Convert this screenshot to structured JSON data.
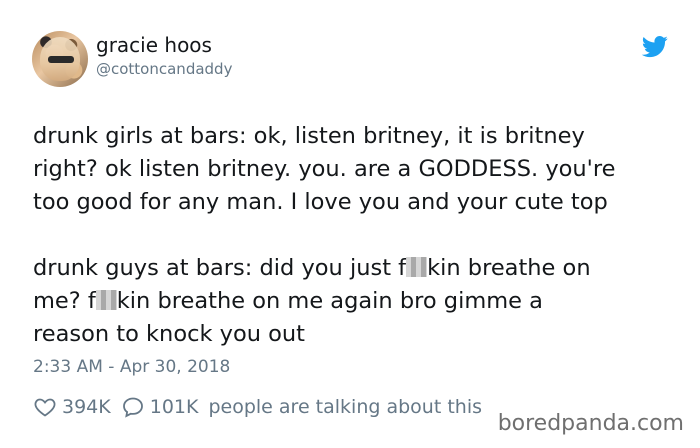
{
  "author": {
    "display_name": "gracie hoos",
    "handle": "@cottoncandaddy"
  },
  "tweet": {
    "paragraph1_lines": [
      "drunk girls at bars: ok, listen britney, it is britney",
      "right? ok listen britney. you. are a GODDESS. you're",
      "too good for any man. I love you and your cute top"
    ],
    "paragraph2": {
      "line1_before": "drunk guys at bars: did you just f",
      "line1_after": "kin breathe on",
      "line2_before": "me? f",
      "line2_after": "kin breathe on me again bro gimme a",
      "line3": "reason to knock you out"
    },
    "timestamp": "2:33 AM - Apr 30, 2018"
  },
  "engagement": {
    "likes": "394K",
    "replies": "101K",
    "talking_text": "people are talking about this"
  },
  "icons": {
    "platform": "twitter-bird-icon",
    "like": "heart-icon",
    "reply": "speech-bubble-icon"
  },
  "colors": {
    "twitter_blue": "#1DA1F2",
    "text_primary": "#14171a",
    "text_secondary": "#657786"
  },
  "watermark": "boredpanda.com"
}
